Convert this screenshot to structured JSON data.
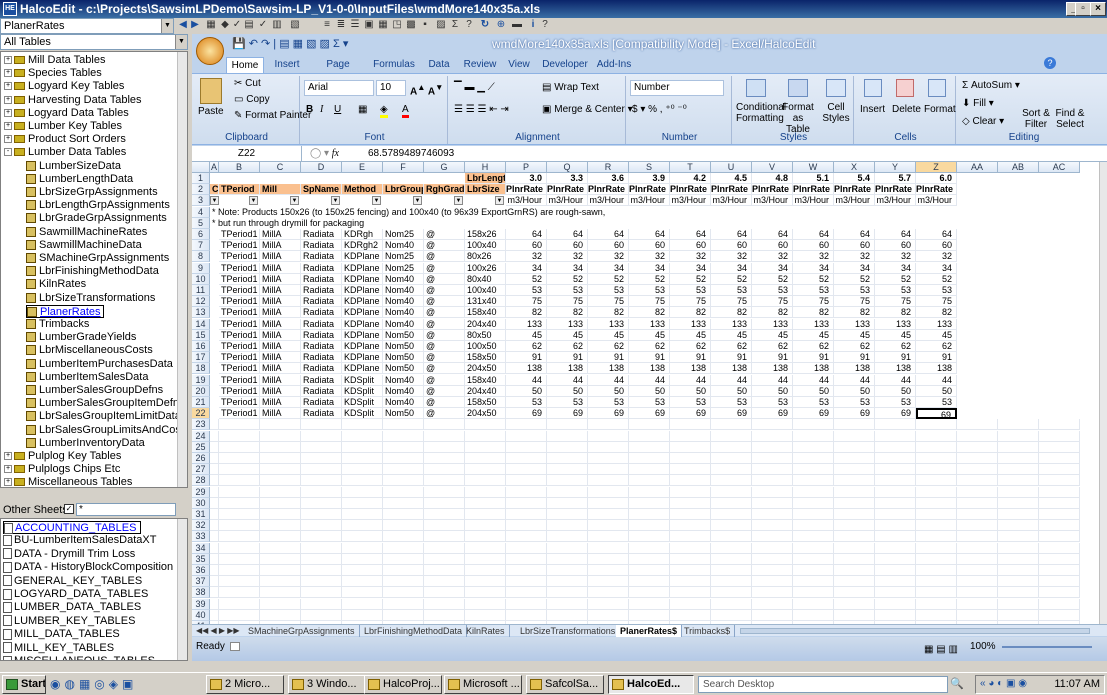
{
  "window": {
    "title": "HalcoEdit - c:\\Projects\\SawsimLPDemo\\Sawsim-LP_V1-0-0\\InputFiles\\wmdMore140x35a.xls",
    "icon": "HE"
  },
  "left": {
    "table_combo": "PlanerRates",
    "filter_combo": "All Tables",
    "tree": [
      {
        "label": "Mill Data Tables",
        "level": 0,
        "type": "folder",
        "exp": "+"
      },
      {
        "label": "Species Tables",
        "level": 0,
        "type": "folder",
        "exp": "+"
      },
      {
        "label": "Logyard Key Tables",
        "level": 0,
        "type": "folder",
        "exp": "+"
      },
      {
        "label": "Harvesting Data Tables",
        "level": 0,
        "type": "folder",
        "exp": "+"
      },
      {
        "label": "Logyard Data Tables",
        "level": 0,
        "type": "folder",
        "exp": "+"
      },
      {
        "label": "Lumber Key Tables",
        "level": 0,
        "type": "folder",
        "exp": "+"
      },
      {
        "label": "Product Sort Orders",
        "level": 0,
        "type": "folder",
        "exp": "+"
      },
      {
        "label": "Lumber Data Tables",
        "level": 0,
        "type": "folder",
        "exp": "-"
      },
      {
        "label": "LumberSizeData",
        "level": 1,
        "type": "table"
      },
      {
        "label": "LumberLengthData",
        "level": 1,
        "type": "table"
      },
      {
        "label": "LbrSizeGrpAssignments",
        "level": 1,
        "type": "table"
      },
      {
        "label": "LbrLengthGrpAssignments",
        "level": 1,
        "type": "table"
      },
      {
        "label": "LbrGradeGrpAssignments",
        "level": 1,
        "type": "table"
      },
      {
        "label": "SawmillMachineRates",
        "level": 1,
        "type": "table"
      },
      {
        "label": "SawmillMachineData",
        "level": 1,
        "type": "table"
      },
      {
        "label": "SMachineGrpAssignments",
        "level": 1,
        "type": "table"
      },
      {
        "label": "LbrFinishingMethodData",
        "level": 1,
        "type": "table"
      },
      {
        "label": "KilnRates",
        "level": 1,
        "type": "table"
      },
      {
        "label": "LbrSizeTransformations",
        "level": 1,
        "type": "table"
      },
      {
        "label": "PlanerRates",
        "level": 1,
        "type": "table",
        "selected": true
      },
      {
        "label": "Trimbacks",
        "level": 1,
        "type": "table"
      },
      {
        "label": "LumberGradeYields",
        "level": 1,
        "type": "table"
      },
      {
        "label": "LbrMiscellaneousCosts",
        "level": 1,
        "type": "table"
      },
      {
        "label": "LumberItemPurchasesData",
        "level": 1,
        "type": "table"
      },
      {
        "label": "LumberItemSalesData",
        "level": 1,
        "type": "table"
      },
      {
        "label": "LumberSalesGroupDefns",
        "level": 1,
        "type": "table"
      },
      {
        "label": "LumberSalesGroupItemDefns",
        "level": 1,
        "type": "table"
      },
      {
        "label": "LbrSalesGroupItemLimitData",
        "level": 1,
        "type": "table"
      },
      {
        "label": "LbrSalesGroupLimitsAndCosts",
        "level": 1,
        "type": "table"
      },
      {
        "label": "LumberInventoryData",
        "level": 1,
        "type": "table"
      },
      {
        "label": "Pulplog Key Tables",
        "level": 0,
        "type": "folder",
        "exp": "+"
      },
      {
        "label": "Pulplogs Chips Etc",
        "level": 0,
        "type": "folder",
        "exp": "+"
      },
      {
        "label": "Miscellaneous Tables",
        "level": 0,
        "type": "folder",
        "exp": "+"
      }
    ],
    "other_label": "Other Sheets",
    "other_filter": "*",
    "other_sheets": [
      "ACCOUNTING_TABLES",
      "BU-LumberItemSalesDataXT",
      "DATA - Drymill Trim Loss",
      "DATA - HistoryBlockComposition",
      "GENERAL_KEY_TABLES",
      "LOGYARD_DATA_TABLES",
      "LUMBER_DATA_TABLES",
      "LUMBER_KEY_TABLES",
      "MILL_DATA_TABLES",
      "MILL_KEY_TABLES",
      "MISCELLANEOUS_TABLES"
    ]
  },
  "excel": {
    "title": "wmdMore140x35a.xls  [Compatibility Mode] - Excel/HalcoEdit",
    "tabs": [
      "Home",
      "Insert",
      "Page Layout",
      "Formulas",
      "Data",
      "Review",
      "View",
      "Developer",
      "Add-Ins"
    ],
    "ribbon": {
      "clipboard": {
        "label": "Clipboard",
        "paste": "Paste",
        "cut": "Cut",
        "copy": "Copy",
        "painter": "Format Painter"
      },
      "font": {
        "label": "Font",
        "name": "Arial",
        "size": "10"
      },
      "alignment": {
        "label": "Alignment",
        "wrap": "Wrap Text",
        "merge": "Merge & Center"
      },
      "number": {
        "label": "Number",
        "format": "Number"
      },
      "styles": {
        "label": "Styles",
        "cond": "Conditional Formatting",
        "table": "Format as Table",
        "cell": "Cell Styles"
      },
      "cells": {
        "label": "Cells",
        "insert": "Insert",
        "delete": "Delete",
        "format": "Format"
      },
      "editing": {
        "label": "Editing",
        "autosum": "AutoSum",
        "fill": "Fill",
        "clear": "Clear",
        "sort": "Sort & Filter",
        "find": "Find & Select"
      }
    },
    "namebox": "Z22",
    "formula": "68.5789489746093",
    "columns": [
      "A",
      "B",
      "C",
      "D",
      "E",
      "F",
      "G",
      "H",
      "P",
      "Q",
      "R",
      "S",
      "T",
      "U",
      "V",
      "W",
      "X",
      "Y",
      "Z",
      "AA",
      "AB",
      "AC"
    ],
    "row1": {
      "H": "LbrLength",
      "P": "3.0",
      "Q": "3.3",
      "R": "3.6",
      "S": "3.9",
      "T": "4.2",
      "U": "4.5",
      "V": "4.8",
      "W": "5.1",
      "X": "5.4",
      "Y": "5.7",
      "Z": "6.0"
    },
    "header_row": [
      "C",
      "TPeriod",
      "Mill",
      "SpName",
      "Method",
      "LbrGroup",
      "RghGrade",
      "LbrSize"
    ],
    "rate_label": "PlnrRate",
    "unit_label": "m3/Hour",
    "note1": "* Note:  Products 150x26 (to 150x25 fencing) and 100x40 (to 96x39 ExportGrnRS) are rough-sawn,",
    "note2": "* but run through drymill for packaging",
    "rows": [
      {
        "r": "6",
        "period": "TPeriod1",
        "mill": "MillA",
        "sp": "Radiata",
        "method": "KDRgh",
        "grp": "Nom25",
        "grade": "@",
        "size": "158x26",
        "v": "64"
      },
      {
        "r": "7",
        "period": "TPeriod1",
        "mill": "MillA",
        "sp": "Radiata",
        "method": "KDRgh2",
        "grp": "Nom40",
        "grade": "@",
        "size": "100x40",
        "v": "60"
      },
      {
        "r": "8",
        "period": "TPeriod1",
        "mill": "MillA",
        "sp": "Radiata",
        "method": "KDPlane",
        "grp": "Nom25",
        "grade": "@",
        "size": "80x26",
        "v": "32"
      },
      {
        "r": "9",
        "period": "TPeriod1",
        "mill": "MillA",
        "sp": "Radiata",
        "method": "KDPlane",
        "grp": "Nom25",
        "grade": "@",
        "size": "100x26",
        "v": "34"
      },
      {
        "r": "10",
        "period": "TPeriod1",
        "mill": "MillA",
        "sp": "Radiata",
        "method": "KDPlane",
        "grp": "Nom40",
        "grade": "@",
        "size": "80x40",
        "v": "52"
      },
      {
        "r": "11",
        "period": "TPeriod1",
        "mill": "MillA",
        "sp": "Radiata",
        "method": "KDPlane",
        "grp": "Nom40",
        "grade": "@",
        "size": "100x40",
        "v": "53"
      },
      {
        "r": "12",
        "period": "TPeriod1",
        "mill": "MillA",
        "sp": "Radiata",
        "method": "KDPlane",
        "grp": "Nom40",
        "grade": "@",
        "size": "131x40",
        "v": "75"
      },
      {
        "r": "13",
        "period": "TPeriod1",
        "mill": "MillA",
        "sp": "Radiata",
        "method": "KDPlane",
        "grp": "Nom40",
        "grade": "@",
        "size": "158x40",
        "v": "82"
      },
      {
        "r": "14",
        "period": "TPeriod1",
        "mill": "MillA",
        "sp": "Radiata",
        "method": "KDPlane",
        "grp": "Nom40",
        "grade": "@",
        "size": "204x40",
        "v": "133"
      },
      {
        "r": "15",
        "period": "TPeriod1",
        "mill": "MillA",
        "sp": "Radiata",
        "method": "KDPlane",
        "grp": "Nom50",
        "grade": "@",
        "size": "80x50",
        "v": "45"
      },
      {
        "r": "16",
        "period": "TPeriod1",
        "mill": "MillA",
        "sp": "Radiata",
        "method": "KDPlane",
        "grp": "Nom50",
        "grade": "@",
        "size": "100x50",
        "v": "62"
      },
      {
        "r": "17",
        "period": "TPeriod1",
        "mill": "MillA",
        "sp": "Radiata",
        "method": "KDPlane",
        "grp": "Nom50",
        "grade": "@",
        "size": "158x50",
        "v": "91"
      },
      {
        "r": "18",
        "period": "TPeriod1",
        "mill": "MillA",
        "sp": "Radiata",
        "method": "KDPlane",
        "grp": "Nom50",
        "grade": "@",
        "size": "204x50",
        "v": "138"
      },
      {
        "r": "19",
        "period": "TPeriod1",
        "mill": "MillA",
        "sp": "Radiata",
        "method": "KDSplit",
        "grp": "Nom40",
        "grade": "@",
        "size": "158x40",
        "v": "44"
      },
      {
        "r": "20",
        "period": "TPeriod1",
        "mill": "MillA",
        "sp": "Radiata",
        "method": "KDSplit",
        "grp": "Nom40",
        "grade": "@",
        "size": "204x40",
        "v": "50"
      },
      {
        "r": "21",
        "period": "TPeriod1",
        "mill": "MillA",
        "sp": "Radiata",
        "method": "KDSplit",
        "grp": "Nom40",
        "grade": "@",
        "size": "158x50",
        "v": "53"
      },
      {
        "r": "22",
        "period": "TPeriod1",
        "mill": "MillA",
        "sp": "Radiata",
        "method": "KDSplit",
        "grp": "Nom50",
        "grade": "@",
        "size": "204x50",
        "v": "69"
      }
    ],
    "empty_rows": [
      "23",
      "24",
      "25",
      "26",
      "27",
      "28",
      "29",
      "30",
      "31",
      "32",
      "33",
      "34",
      "35",
      "36",
      "37",
      "38",
      "39",
      "40",
      "41"
    ],
    "sheet_tabs": [
      "SMachineGrpAssignments",
      "LbrFinishingMethodData",
      "KilnRates",
      "LbrSizeTransformations",
      "PlanerRates$",
      "Trimbacks$"
    ],
    "status": "Ready",
    "zoom": "100%"
  },
  "taskbar": {
    "start": "Start",
    "buttons": [
      "2 Micro...",
      "3 Windo...",
      "HalcoProj...",
      "Microsoft ...",
      "SafcolSa...",
      "HalcoEd..."
    ],
    "search": "Search Desktop",
    "clock": "11:07 AM"
  }
}
